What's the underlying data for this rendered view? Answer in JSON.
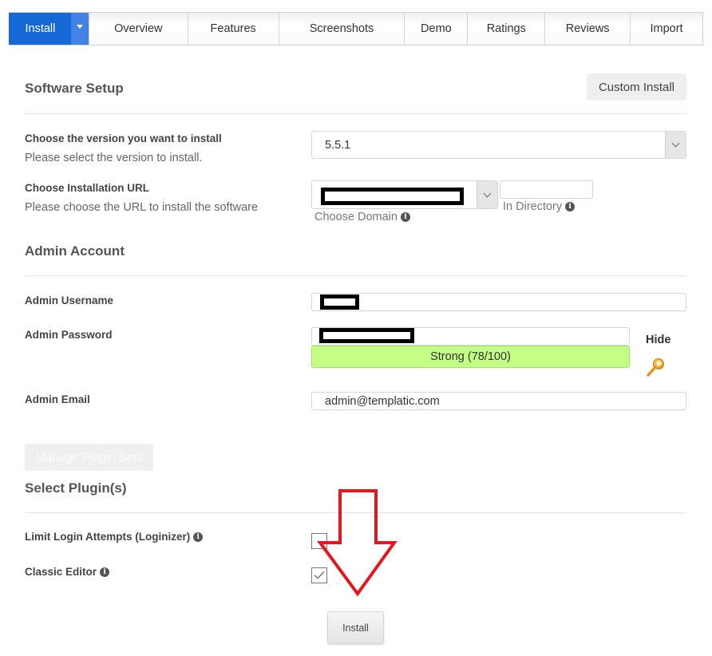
{
  "tabs": [
    {
      "label": "Install",
      "active": true
    },
    {
      "label": "Overview"
    },
    {
      "label": "Features"
    },
    {
      "label": "Screenshots"
    },
    {
      "label": "Demo"
    },
    {
      "label": "Ratings"
    },
    {
      "label": "Reviews"
    },
    {
      "label": "Import"
    }
  ],
  "software_setup": {
    "title": "Software Setup",
    "custom_install_label": "Custom Install",
    "version": {
      "label": "Choose the version you want to install",
      "help": "Please select the version to install.",
      "value": "5.5.1"
    },
    "url": {
      "label": "Choose Installation URL",
      "help": "Please choose the URL to install the software",
      "domain_value": "[redacted]",
      "domain_caption": "Choose Domain",
      "directory_value": "",
      "directory_caption": "In Directory"
    }
  },
  "admin_account": {
    "title": "Admin Account",
    "username_label": "Admin Username",
    "username_value": "[redacted]",
    "password_label": "Admin Password",
    "password_value": "[redacted]",
    "password_strength_text": "Strong (78/100)",
    "password_strength_score": 78,
    "password_strength_color": "#c3fe85",
    "hide_label": "Hide",
    "email_label": "Admin Email",
    "email_value": "admin@templatic.com"
  },
  "plugins": {
    "manage_label": "Manage Plugin Sets",
    "title": "Select Plugin(s)",
    "items": [
      {
        "label": "Limit Login Attempts (Loginizer)",
        "checked": false
      },
      {
        "label": "Classic Editor",
        "checked": true
      }
    ]
  },
  "install_button_label": "Install",
  "annotation": {
    "type": "arrow-down",
    "color": "#e8141e"
  },
  "colors": {
    "accent": "#1569d6",
    "accent_light": "#4282e6"
  }
}
